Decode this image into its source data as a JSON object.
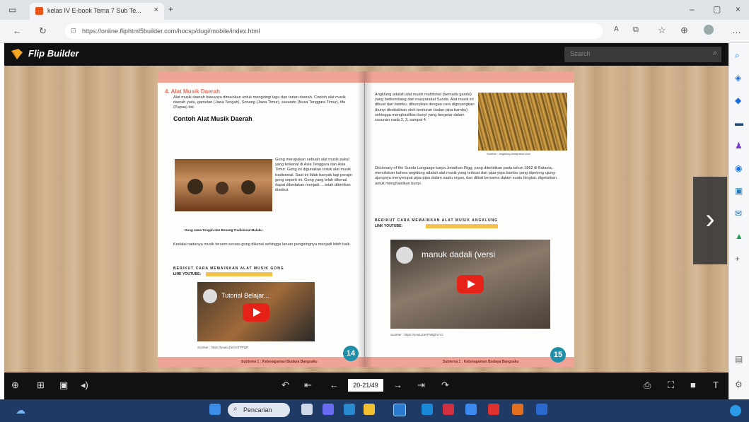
{
  "browser": {
    "tab_title": "kelas IV E-book Tema 7 Sub Te...",
    "tab_close": "×",
    "new_tab": "+",
    "url": "https://online.fliphtml5builder.com/hocsp/dugi/mobile/index.html",
    "window_min": "–",
    "window_max": "▢",
    "window_close": "×"
  },
  "flip": {
    "brand": "Flip Builder",
    "search_placeholder": "Search"
  },
  "left_page": {
    "section_title": "4. Alat Musik Daerah",
    "intro": "Alat musik daerah biasanya dimainkan untuk mengiringi lagu dan tarian daerah. Contoh alat musik daerah yaitu, gamelan (Jawa Tengah), Sonang (Jawa Timur), sasando (Nusa Tenggara Timur), tifa (Papua) dsl.",
    "heading": "Contoh Alat Musik Daerah",
    "gong_text": "Gong merupakan sebuah alat musik pukul yang terkenal di Asia Tenggara dan Asia Timur. Gong ini digunakan untuk alat musik tradisional. Saat ini tidak banyak lagi perajin gong seperti ini. Gong yang telah dikenal dapat dibedakan menjadi ... telah diberikan disebut.",
    "caption": "Gong Jawa Tengah dan Bonang Tradisional Maluku",
    "follow_text": "Kedalai nadanya musik tersem secara gong dikenal sehingga laruan pengiringnya menjadi lebih baik.",
    "video_heading": "BERIKUT CARA MEMAINKAN ALAT MUSIK GONG",
    "video_link_label": "LINK YOUTUBE:",
    "video_title": "Tutorial Belajar...",
    "video_source": "Sumber : https://youtu.be/nXTFPQR",
    "footer": "Subtema 1 : Keberagaman Budaya Bangsaku",
    "page_number": "14"
  },
  "right_page": {
    "para1": "Angklung adalah alat musik multitonal (bernada ganda) yang berkembang dari masyarakat Sunda. Alat musik ini dibuat dari bambu, dibunyikan dengan cara digoyangkan (bunyi disebabkan oleh benturan badan pipa bambu) sehingga menghasilkan bunyi yang bergetar dalam susunan nada 2, 3, sampai 4.",
    "para2": "Dictionary of the Sunda Language karya Jonathan Rigg, yang diterbitkan pada tahun 1862 di Batavia, menuliskan bahwa angklung adalah alat musik yang terbuat dari pipa-pipa bambu yang dipotong ujung-ujungnya menyerupai pipa-pipa dalam suatu organ, dan diikat bersama dalam suatu bingkai, digetarkan untuk menghasilkan bunyi.",
    "image_caption": "Sumber : angklung.wordpress.com",
    "video_heading": "BERIKUT CARA MEMAINKAN ALAT MUSIK ANGKLUNG",
    "video_link_label": "LINK YOUTUBE:",
    "video_title": "manuk dadali (versi",
    "video_source": "Sumber : https://youtu.be/TN8gbYCO",
    "footer": "Subtema 1 : Keberagaman Budaya Bangsaku",
    "page_number": "15"
  },
  "toolbar": {
    "page_display": "20-21/49"
  },
  "taskbar": {
    "search_label": "Pencarian"
  }
}
